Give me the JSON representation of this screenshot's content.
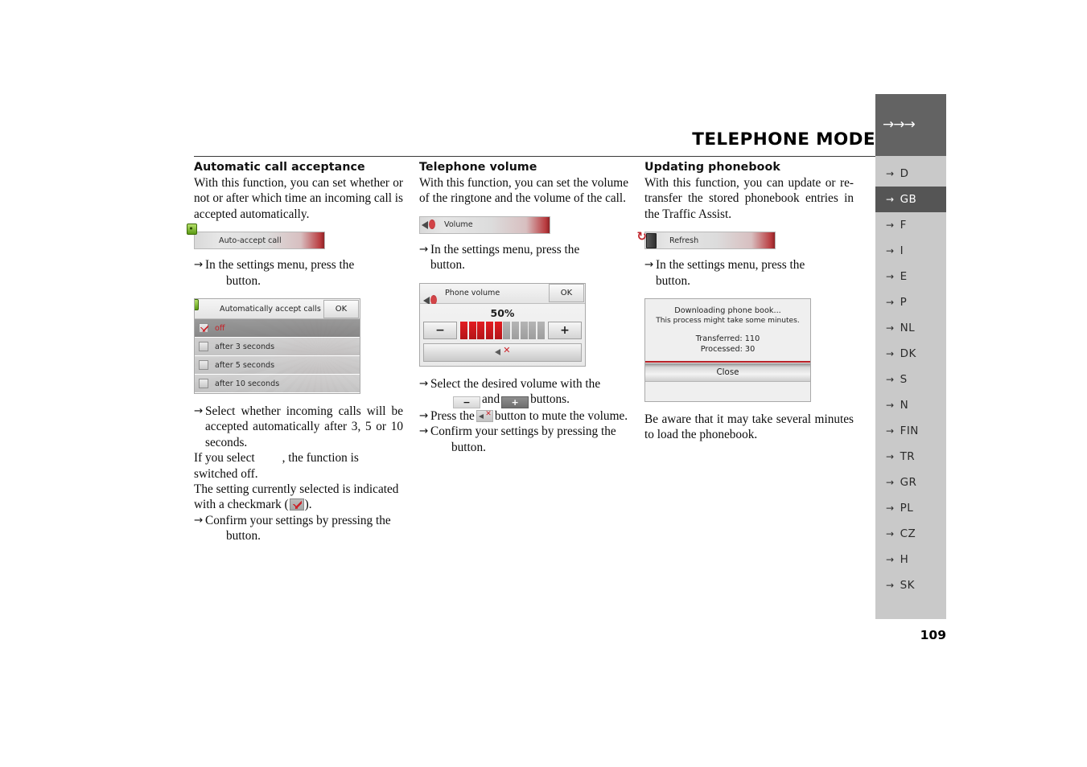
{
  "header": {
    "title": "TELEPHONE MODE",
    "arrows": "→→→"
  },
  "page_number": "109",
  "sidebar": {
    "items": [
      {
        "label": "D",
        "active": false
      },
      {
        "label": "GB",
        "active": true
      },
      {
        "label": "F",
        "active": false
      },
      {
        "label": "I",
        "active": false
      },
      {
        "label": "E",
        "active": false
      },
      {
        "label": "P",
        "active": false
      },
      {
        "label": "NL",
        "active": false
      },
      {
        "label": "DK",
        "active": false
      },
      {
        "label": "S",
        "active": false
      },
      {
        "label": "N",
        "active": false
      },
      {
        "label": "FIN",
        "active": false
      },
      {
        "label": "TR",
        "active": false
      },
      {
        "label": "GR",
        "active": false
      },
      {
        "label": "PL",
        "active": false
      },
      {
        "label": "CZ",
        "active": false
      },
      {
        "label": "H",
        "active": false
      },
      {
        "label": "SK",
        "active": false
      }
    ],
    "arrow_glyph": "→"
  },
  "columns": {
    "col1": {
      "title": "Automatic call acceptance",
      "intro": "With this function, you can set whether or not or after which time an incoming call is accepted automatically.",
      "menu_button_label": "Auto-accept call",
      "step1_text": "In the settings menu, press the",
      "step1_cont": "button.",
      "dialog": {
        "title": "Automatically accept calls",
        "ok_label": "OK",
        "rows": [
          {
            "label": "off",
            "selected": true
          },
          {
            "label": "after 3 seconds",
            "selected": false
          },
          {
            "label": "after 5 seconds",
            "selected": false
          },
          {
            "label": "after 10 seconds",
            "selected": false
          }
        ]
      },
      "step2_text": "Select whether incoming calls will be accepted automatically after 3, 5 or 10 seconds.",
      "note1_a": "If you select",
      "note1_b": ", the function is switched off.",
      "note2_a": "The setting currently selected is indicated with a checkmark (",
      "note2_b": ").",
      "step3_text": "Confirm your settings by pressing the",
      "step3_cont": "button."
    },
    "col2": {
      "title": "Telephone volume",
      "intro": "With this function, you can set the volume of the ringtone and the volume of the call.",
      "menu_button_label": "Volume",
      "step1_text": "In the settings menu, press the",
      "step1_cont": "button.",
      "dialog": {
        "title": "Phone volume",
        "ok_label": "OK",
        "percent_label": "50%",
        "percent_value": 50,
        "segments_total": 10,
        "segments_on": 5,
        "minus_label": "−",
        "plus_label": "+"
      },
      "step2_a": "Select the desired volume with the",
      "step2_minus": "−",
      "step2_and": "and",
      "step2_plus": "+",
      "step2_b": "buttons.",
      "step3_a": "Press the",
      "step3_b": "button to mute the volume.",
      "step4_text": "Confirm your settings by pressing the",
      "step4_cont": "button."
    },
    "col3": {
      "title": "Updating phonebook",
      "intro": "With this function, you can update or re-transfer the stored phonebook entries in the Traffic Assist.",
      "menu_button_label": "Refresh",
      "step1_text": "In the settings menu, press the",
      "step1_cont": "button.",
      "dialog": {
        "line1": "Downloading phone book...",
        "line2": "This process might take some minutes.",
        "transferred": "Transferred: 110",
        "processed": "Processed: 30",
        "close_label": "Close"
      },
      "outro": "Be aware that it may take several minutes to load the phonebook."
    }
  },
  "icons": {
    "phone_accept": "phone-accept-icon",
    "speaker": "speaker-icon",
    "refresh": "refresh-icon",
    "mute": "mute-icon",
    "checkmark": "checkmark-icon"
  },
  "colors": {
    "accent_red": "#c0272d",
    "tab_active_bg": "#555555",
    "tab_bg": "#c9c9c9",
    "header_box_bg": "#636363"
  }
}
